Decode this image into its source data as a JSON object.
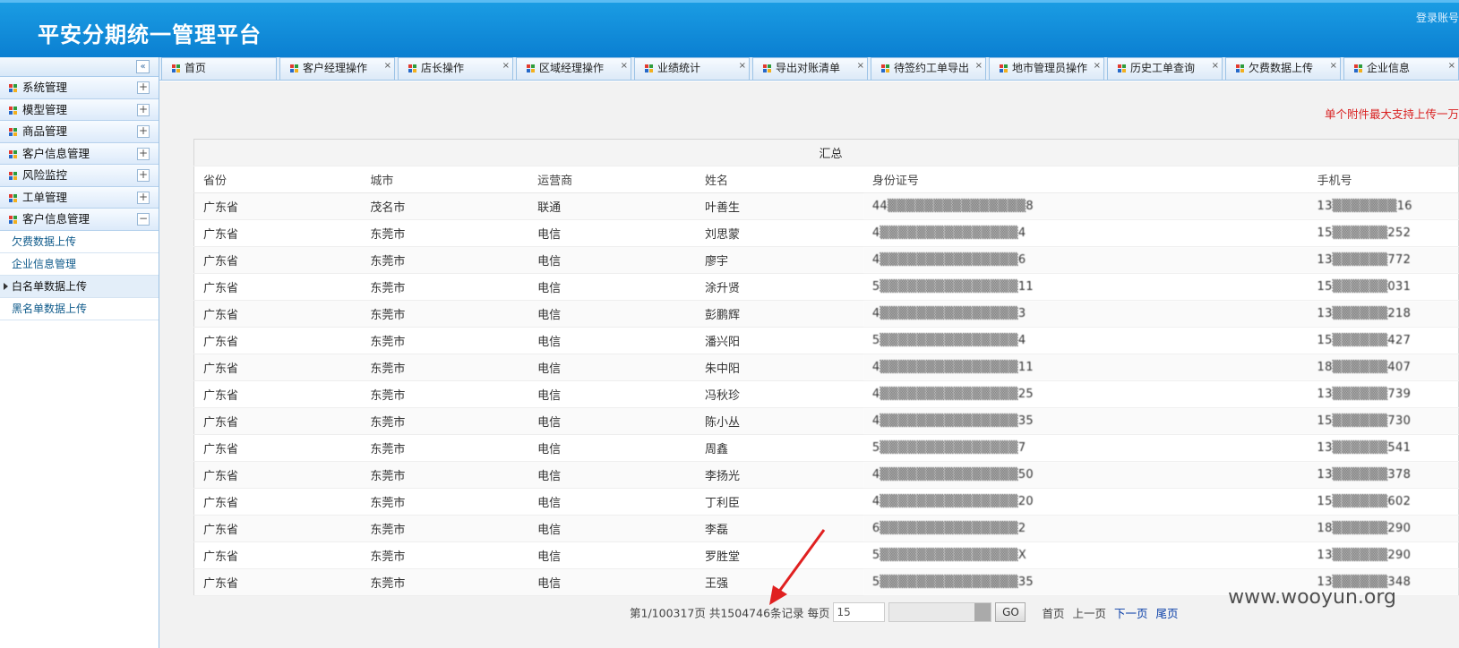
{
  "header": {
    "title": "平安分期统一管理平台",
    "login_link": "登录账号"
  },
  "sidebar": {
    "groups": [
      {
        "label": "系统管理",
        "toggle": "+"
      },
      {
        "label": "模型管理",
        "toggle": "+"
      },
      {
        "label": "商品管理",
        "toggle": "+"
      },
      {
        "label": "客户信息管理",
        "toggle": "+"
      },
      {
        "label": "风险监控",
        "toggle": "+"
      },
      {
        "label": "工单管理",
        "toggle": "+"
      },
      {
        "label": "客户信息管理",
        "toggle": "−"
      }
    ],
    "sub_items": [
      "欠费数据上传",
      "企业信息管理",
      "白名单数据上传",
      "黑名单数据上传"
    ],
    "collapse_glyph": "«"
  },
  "tabs": [
    "首页",
    "客户经理操作",
    "店长操作",
    "区域经理操作",
    "业绩统计",
    "导出对账清单",
    "待签约工单导出",
    "地市管理员操作",
    "历史工单查询",
    "欠费数据上传",
    "企业信息"
  ],
  "tab_close": "×",
  "notice": "单个附件最大支持上传一万",
  "table": {
    "summary": "汇总",
    "headers": [
      "省份",
      "城市",
      "运营商",
      "姓名",
      "身份证号",
      "手机号"
    ],
    "rows": [
      [
        "广东省",
        "茂名市",
        "联通",
        "叶善生",
        "44▒▒▒▒▒▒▒▒▒▒▒▒▒▒▒8",
        "13▒▒▒▒▒▒▒16"
      ],
      [
        "广东省",
        "东莞市",
        "电信",
        "刘思蒙",
        "4▒▒▒▒▒▒▒▒▒▒▒▒▒▒▒4",
        "15▒▒▒▒▒▒252"
      ],
      [
        "广东省",
        "东莞市",
        "电信",
        "廖宇",
        "4▒▒▒▒▒▒▒▒▒▒▒▒▒▒▒6",
        "13▒▒▒▒▒▒772"
      ],
      [
        "广东省",
        "东莞市",
        "电信",
        "涂升贤",
        "5▒▒▒▒▒▒▒▒▒▒▒▒▒▒▒11",
        "15▒▒▒▒▒▒031"
      ],
      [
        "广东省",
        "东莞市",
        "电信",
        "彭鹏辉",
        "4▒▒▒▒▒▒▒▒▒▒▒▒▒▒▒3",
        "13▒▒▒▒▒▒218"
      ],
      [
        "广东省",
        "东莞市",
        "电信",
        "潘兴阳",
        "5▒▒▒▒▒▒▒▒▒▒▒▒▒▒▒4",
        "15▒▒▒▒▒▒427"
      ],
      [
        "广东省",
        "东莞市",
        "电信",
        "朱中阳",
        "4▒▒▒▒▒▒▒▒▒▒▒▒▒▒▒11",
        "18▒▒▒▒▒▒407"
      ],
      [
        "广东省",
        "东莞市",
        "电信",
        "冯秋珍",
        "4▒▒▒▒▒▒▒▒▒▒▒▒▒▒▒25",
        "13▒▒▒▒▒▒739"
      ],
      [
        "广东省",
        "东莞市",
        "电信",
        "陈小丛",
        "4▒▒▒▒▒▒▒▒▒▒▒▒▒▒▒35",
        "15▒▒▒▒▒▒730"
      ],
      [
        "广东省",
        "东莞市",
        "电信",
        "周鑫",
        "5▒▒▒▒▒▒▒▒▒▒▒▒▒▒▒7",
        "13▒▒▒▒▒▒541"
      ],
      [
        "广东省",
        "东莞市",
        "电信",
        "李扬光",
        "4▒▒▒▒▒▒▒▒▒▒▒▒▒▒▒50",
        "13▒▒▒▒▒▒378"
      ],
      [
        "广东省",
        "东莞市",
        "电信",
        "丁利臣",
        "4▒▒▒▒▒▒▒▒▒▒▒▒▒▒▒20",
        "15▒▒▒▒▒▒602"
      ],
      [
        "广东省",
        "东莞市",
        "电信",
        "李磊",
        "6▒▒▒▒▒▒▒▒▒▒▒▒▒▒▒2",
        "18▒▒▒▒▒▒290"
      ],
      [
        "广东省",
        "东莞市",
        "电信",
        "罗胜堂",
        "5▒▒▒▒▒▒▒▒▒▒▒▒▒▒▒X",
        "13▒▒▒▒▒▒290"
      ],
      [
        "广东省",
        "东莞市",
        "电信",
        "王强",
        "5▒▒▒▒▒▒▒▒▒▒▒▒▒▒▒35",
        "13▒▒▒▒▒▒348"
      ]
    ]
  },
  "pager": {
    "summary": "第1/100317页 共1504746条记录 每页",
    "page_size": "15",
    "go_label": "GO",
    "first": "首页",
    "prev": "上一页",
    "next": "下一页",
    "last": "尾页"
  },
  "watermark": "www.wooyun.org",
  "colors": {
    "header": "#0b7fd1",
    "notice": "#d81f1f",
    "arrow": "#e02020"
  }
}
